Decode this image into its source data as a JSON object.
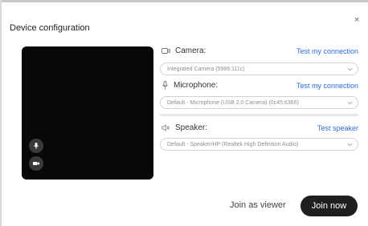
{
  "dialog": {
    "title": "Device configuration",
    "close_label": "×"
  },
  "camera": {
    "label": "Camera:",
    "icon": "camera-icon",
    "test_link": "Test my connection",
    "selected": "Integrated Camera (5986:111c)"
  },
  "microphone": {
    "label": "Microphone:",
    "icon": "microphone-icon",
    "test_link": "Test my connection",
    "selected": "Default - Microphone (USB 2.0 Camera) (0c45:6366)",
    "level": 0
  },
  "speaker": {
    "label": "Speaker:",
    "icon": "speaker-icon",
    "test_link": "Test speaker",
    "selected": "Default - Speaker/HP (Realtek High Definition Audio)"
  },
  "actions": {
    "join_viewer": "Join as viewer",
    "join_now": "Join now"
  },
  "colors": {
    "link": "#2d6cdf",
    "join_button": "#1f1f1f",
    "preview": "#080808"
  }
}
